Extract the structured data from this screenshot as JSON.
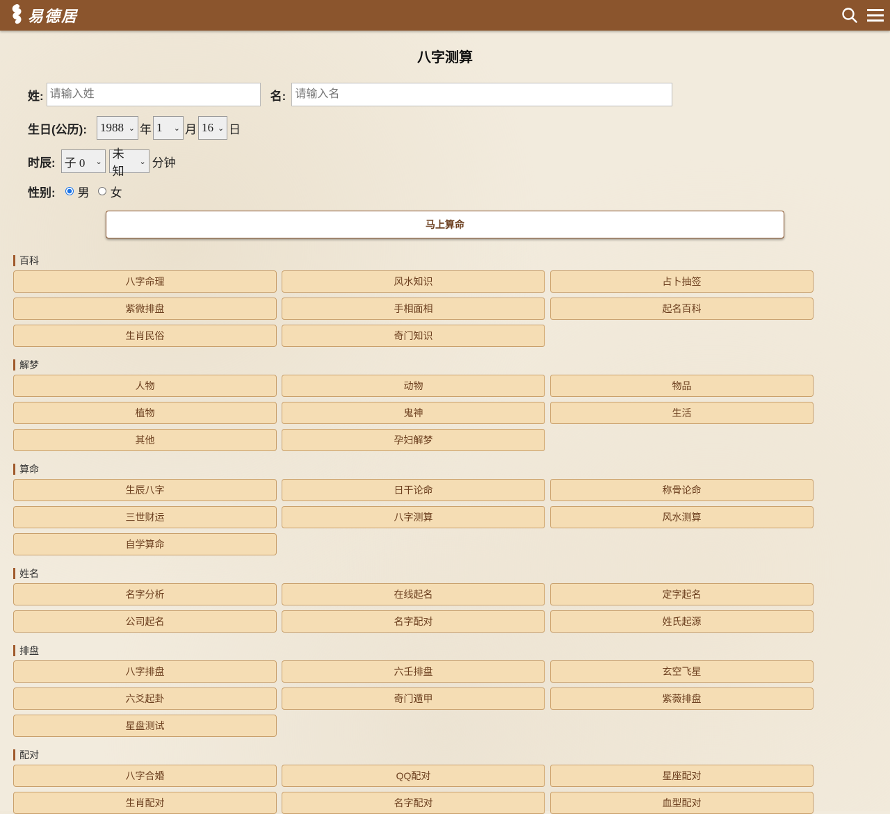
{
  "header": {
    "logo_mark": "𝓢",
    "logo_text": "易德居"
  },
  "page_title": "八字测算",
  "form": {
    "surname_label": "姓:",
    "surname_placeholder": "请输入姓",
    "given_label": "名:",
    "given_placeholder": "请输入名",
    "birthday_label": "生日(公历):",
    "year": "1988",
    "year_unit": "年",
    "month": "1",
    "month_unit": "月",
    "day": "16",
    "day_unit": "日",
    "hour_label": "时辰:",
    "hour": "子 0",
    "minute": "未知",
    "minute_unit": "分钟",
    "gender_label": "性别:",
    "gender_male": "男",
    "gender_female": "女",
    "submit": "马上算命"
  },
  "sections": [
    {
      "title": "百科",
      "items": [
        "八字命理",
        "风水知识",
        "占卜抽签",
        "紫微排盘",
        "手相面相",
        "起名百科",
        "生肖民俗",
        "奇门知识"
      ]
    },
    {
      "title": "解梦",
      "items": [
        "人物",
        "动物",
        "物品",
        "植物",
        "鬼神",
        "生活",
        "其他",
        "孕妇解梦"
      ]
    },
    {
      "title": "算命",
      "items": [
        "生辰八字",
        "日干论命",
        "称骨论命",
        "三世财运",
        "八字测算",
        "风水测算",
        "自学算命"
      ]
    },
    {
      "title": "姓名",
      "items": [
        "名字分析",
        "在线起名",
        "定字起名",
        "公司起名",
        "名字配对",
        "姓氏起源"
      ]
    },
    {
      "title": "排盘",
      "items": [
        "八字排盘",
        "六壬排盘",
        "玄空飞星",
        "六爻起卦",
        "奇门遁甲",
        "紫薇排盘",
        "星盘测试"
      ]
    },
    {
      "title": "配对",
      "items": [
        "八字合婚",
        "QQ配对",
        "星座配对",
        "生肖配对",
        "名字配对",
        "血型配对"
      ]
    }
  ]
}
